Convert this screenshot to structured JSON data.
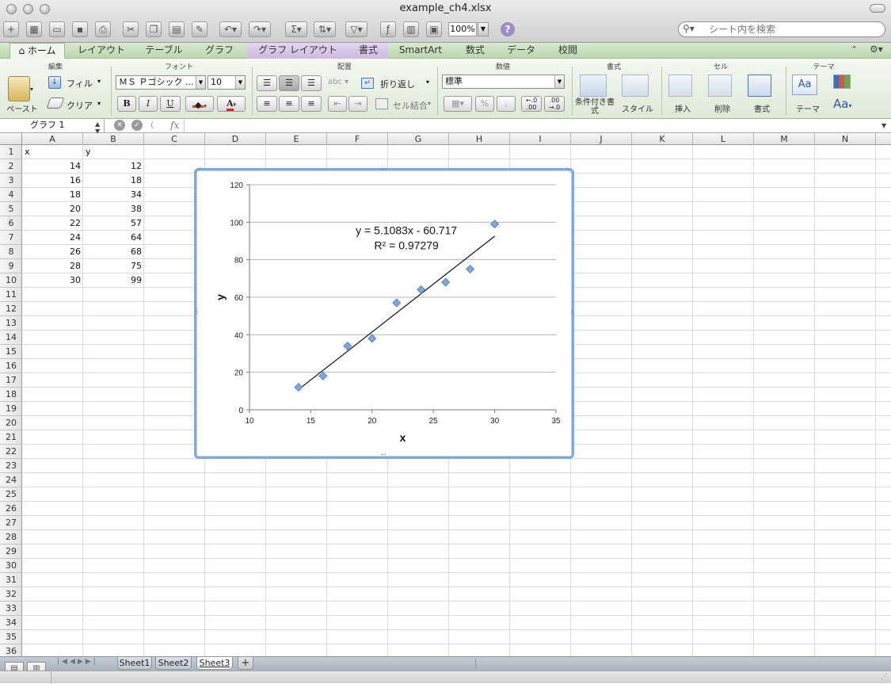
{
  "window": {
    "title": "example_ch4.xlsx"
  },
  "toolbar": {
    "zoom": "100%",
    "help": "?"
  },
  "search": {
    "placeholder": "シート内を検索"
  },
  "ribbon_tabs": [
    {
      "label": "ホーム",
      "active": true
    },
    {
      "label": "レイアウト"
    },
    {
      "label": "テーブル"
    },
    {
      "label": "グラフ"
    },
    {
      "label": "グラフ レイアウト",
      "contextual": true
    },
    {
      "label": "書式",
      "contextual": true
    },
    {
      "label": "SmartArt"
    },
    {
      "label": "数式"
    },
    {
      "label": "データ"
    },
    {
      "label": "校閲"
    }
  ],
  "ribbon": {
    "groups": {
      "edit": "編集",
      "font": "フォント",
      "align": "配置",
      "number": "数値",
      "format": "書式",
      "cells": "セル",
      "theme": "テーマ"
    },
    "paste": "ペースト",
    "fill": "フィル",
    "clear": "クリア",
    "font_name": "ＭＳ Ｐゴシック ...",
    "font_size": "10",
    "bold": "B",
    "italic": "I",
    "underline": "U",
    "font_color_letter": "A",
    "wrap": "折り返し",
    "merge": "セル結合",
    "number_format": "標準",
    "percent": "%",
    "comma": "」",
    "cond_format": "条件付き書式",
    "style": "スタイル",
    "insert": "挿入",
    "delete": "削除",
    "format_btn": "書式",
    "theme_btn": "テーマ",
    "aa": "Aa",
    "abc": "abc"
  },
  "formula_bar": {
    "name_box": "グラフ 1",
    "fx": "fx",
    "value": ""
  },
  "columns": [
    "A",
    "B",
    "C",
    "D",
    "E",
    "F",
    "G",
    "H",
    "I",
    "J",
    "K",
    "L",
    "M",
    "N"
  ],
  "rows": [
    "1",
    "2",
    "3",
    "4",
    "5",
    "6",
    "7",
    "8",
    "9",
    "10",
    "11",
    "12",
    "13",
    "14",
    "15",
    "16",
    "17",
    "18",
    "19",
    "20",
    "21",
    "22",
    "23",
    "24",
    "25",
    "26",
    "27",
    "28",
    "29",
    "30",
    "31",
    "32",
    "33",
    "34",
    "35",
    "36"
  ],
  "sheet": {
    "header": [
      "x",
      "y"
    ],
    "data": [
      [
        "14",
        "12"
      ],
      [
        "16",
        "18"
      ],
      [
        "18",
        "34"
      ],
      [
        "20",
        "38"
      ],
      [
        "22",
        "57"
      ],
      [
        "24",
        "64"
      ],
      [
        "26",
        "68"
      ],
      [
        "28",
        "75"
      ],
      [
        "30",
        "99"
      ]
    ]
  },
  "chart_data": {
    "type": "scatter",
    "x": [
      14,
      16,
      18,
      20,
      22,
      24,
      26,
      28,
      30
    ],
    "y": [
      12,
      18,
      34,
      38,
      57,
      64,
      68,
      75,
      99
    ],
    "xlabel": "x",
    "ylabel": "y",
    "xlim": [
      10,
      35
    ],
    "ylim": [
      0,
      120
    ],
    "xticks": [
      "10",
      "15",
      "20",
      "25",
      "30",
      "35"
    ],
    "yticks": [
      "0",
      "20",
      "40",
      "60",
      "80",
      "100",
      "120"
    ],
    "grid": "horizontal",
    "trendline": {
      "type": "linear",
      "slope": 5.1083,
      "intercept": -60.717,
      "equation": "y = 5.1083x - 60.717",
      "r2": "R² = 0.97279"
    },
    "marker_color": "#7fa6d8"
  },
  "sheet_tabs": [
    {
      "label": "Sheet1"
    },
    {
      "label": "Sheet2"
    },
    {
      "label": "Sheet3",
      "active": true
    }
  ],
  "colors": {
    "ribbon": "#cfe2c5",
    "chart_frame": "#7fa9dc",
    "marker": "#7fa6d8"
  }
}
